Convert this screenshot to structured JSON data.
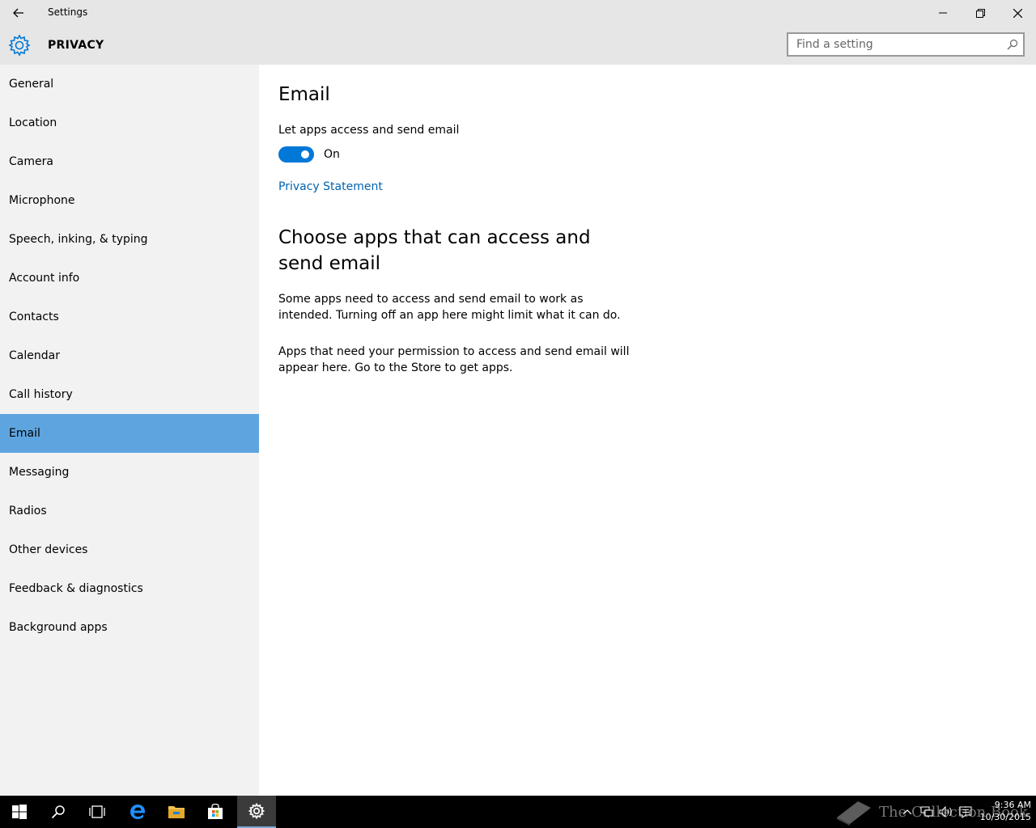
{
  "window": {
    "title": "Settings"
  },
  "header": {
    "section_title": "PRIVACY",
    "search_placeholder": "Find a setting"
  },
  "sidebar": {
    "items": [
      {
        "label": "General"
      },
      {
        "label": "Location"
      },
      {
        "label": "Camera"
      },
      {
        "label": "Microphone"
      },
      {
        "label": "Speech, inking, & typing"
      },
      {
        "label": "Account info"
      },
      {
        "label": "Contacts"
      },
      {
        "label": "Calendar"
      },
      {
        "label": "Call history"
      },
      {
        "label": "Email",
        "selected": true
      },
      {
        "label": "Messaging"
      },
      {
        "label": "Radios"
      },
      {
        "label": "Other devices"
      },
      {
        "label": "Feedback & diagnostics"
      },
      {
        "label": "Background apps"
      }
    ]
  },
  "main": {
    "title": "Email",
    "toggle_label": "Let apps access and send email",
    "toggle_state": "On",
    "toggle_on": true,
    "privacy_link": "Privacy Statement",
    "section_heading": "Choose apps that can access and send email",
    "paragraph1": "Some apps need to access and send email to work as intended. Turning off an app here might limit what it can do.",
    "paragraph2": "Apps that need your permission to access and send email will appear here. Go to the Store to get apps."
  },
  "taskbar": {
    "items": [
      "windows-start-icon",
      "search-icon",
      "task-view-icon",
      "edge-icon",
      "file-explorer-icon",
      "store-icon",
      "settings-icon"
    ],
    "active": "settings-icon",
    "clock_time": "9:36 AM",
    "clock_date": "10/30/2015",
    "watermark_text": "The Collection Book"
  },
  "colors": {
    "accent": "#0078d7",
    "selected_nav": "#5ea5e0",
    "link": "#0063b1",
    "chrome": "#e6e6e6",
    "sidebar": "#f2f2f2"
  }
}
